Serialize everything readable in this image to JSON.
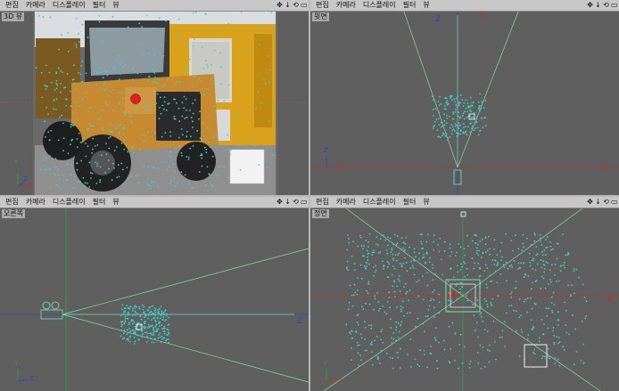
{
  "menu": {
    "edit": "편집",
    "camera": "카메라",
    "display": "디스플레이",
    "filter": "필터",
    "view": "뷰"
  },
  "viewports": {
    "persp": {
      "label": "3D 뷰"
    },
    "top": {
      "label": "윗면"
    },
    "right": {
      "label": "오른쪽"
    },
    "front": {
      "label": "정면"
    }
  },
  "axes": {
    "x": "X",
    "y": "Y",
    "z": "Z"
  },
  "colors": {
    "viewport_bg": "#5f5f5f",
    "points": "#3fd0c8",
    "frustum": "#7fe0a8",
    "x_axis": "#c03030",
    "z_axis": "#3040c0",
    "y_axis": "#30a040"
  },
  "icons": [
    "move-icon",
    "download-icon",
    "refresh-icon",
    "maximize-icon"
  ]
}
